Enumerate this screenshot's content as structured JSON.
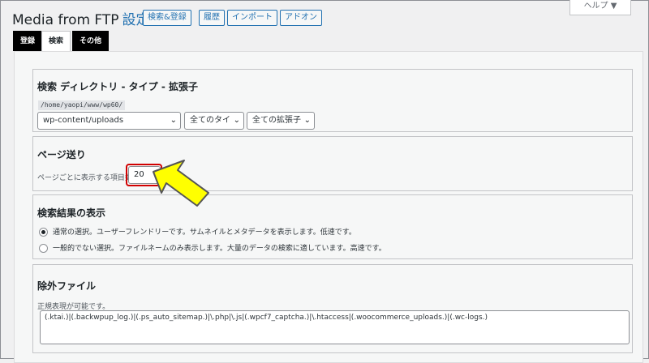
{
  "header": {
    "title": "Media from FTP",
    "subtitle": "設定",
    "buttons": [
      "検索&登録",
      "履歴",
      "インポート",
      "アドオン"
    ],
    "help": "ヘルプ ▼"
  },
  "tabs": [
    {
      "label": "登録",
      "active": false
    },
    {
      "label": "検索",
      "active": true
    },
    {
      "label": "その他",
      "active": false
    }
  ],
  "search_dir": {
    "title": "検索 ディレクトリ - タイプ - 拡張子",
    "path": "/home/yaopi/www/wp60/",
    "dir_select": "wp-content/uploads",
    "type_select": "全てのタイ",
    "ext_select": "全ての拡張子"
  },
  "paging": {
    "title": "ページ送り",
    "label": "ページごとに表示する項目数",
    "value": "20"
  },
  "results": {
    "title": "検索結果の表示",
    "options": [
      {
        "label": "通常の選択。ユーザーフレンドリーです。サムネイルとメタデータを表示します。低速です。",
        "checked": true
      },
      {
        "label": "一般的でない選択。ファイルネームのみ表示します。大量のデータの検索に適しています。高速です。",
        "checked": false
      }
    ]
  },
  "exclude": {
    "title": "除外ファイル",
    "hint": "正規表現が可能です。",
    "value": "(.ktai.)|(.backwpup_log.)|(.ps_auto_sitemap.)|\\.php|\\.js|(.wpcf7_captcha.)|\\.htaccess|(.woocommerce_uploads.)|(.wc-logs.)"
  },
  "colors": {
    "accent": "#2271b1",
    "highlight": "#d10000",
    "arrow_fill": "#ffff00"
  }
}
